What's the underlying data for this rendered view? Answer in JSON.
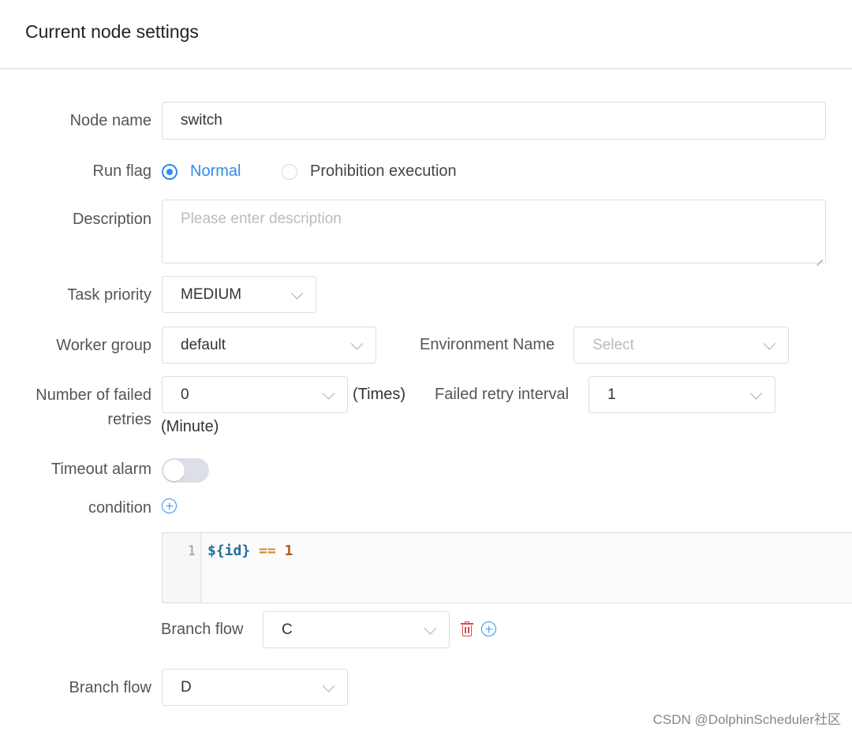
{
  "header": {
    "title": "Current node settings"
  },
  "form": {
    "node_name": {
      "label": "Node name",
      "value": "switch"
    },
    "run_flag": {
      "label": "Run flag",
      "options": [
        {
          "label": "Normal",
          "checked": true
        },
        {
          "label": "Prohibition execution",
          "checked": false
        }
      ]
    },
    "description": {
      "label": "Description",
      "placeholder": "Please enter description"
    },
    "task_priority": {
      "label": "Task priority",
      "value": "MEDIUM"
    },
    "worker_group": {
      "label": "Worker group",
      "value": "default"
    },
    "environment": {
      "label": "Environment Name",
      "placeholder": "Select"
    },
    "failed_retries": {
      "label_line1": "Number of failed",
      "label_line2": "retries",
      "value": "0",
      "suffix": "(Times)"
    },
    "retry_interval": {
      "label": "Failed retry interval",
      "value": "1",
      "suffix": "(Minute)"
    },
    "timeout_alarm": {
      "label": "Timeout alarm",
      "enabled": false
    },
    "condition": {
      "label": "condition",
      "editor": {
        "line_number": "1",
        "var": "${id}",
        "op": "==",
        "num": "1"
      }
    },
    "branch_flow_inner": {
      "label": "Branch flow",
      "value": "C"
    },
    "branch_flow": {
      "label": "Branch flow",
      "value": "D"
    }
  },
  "watermark": "CSDN @DolphinScheduler社区",
  "icons": {
    "add": "plus-circle-icon",
    "delete": "trash-icon",
    "dropdown": "chevron-down-icon"
  },
  "colors": {
    "accent": "#2d8cf0",
    "danger": "#e04545"
  }
}
